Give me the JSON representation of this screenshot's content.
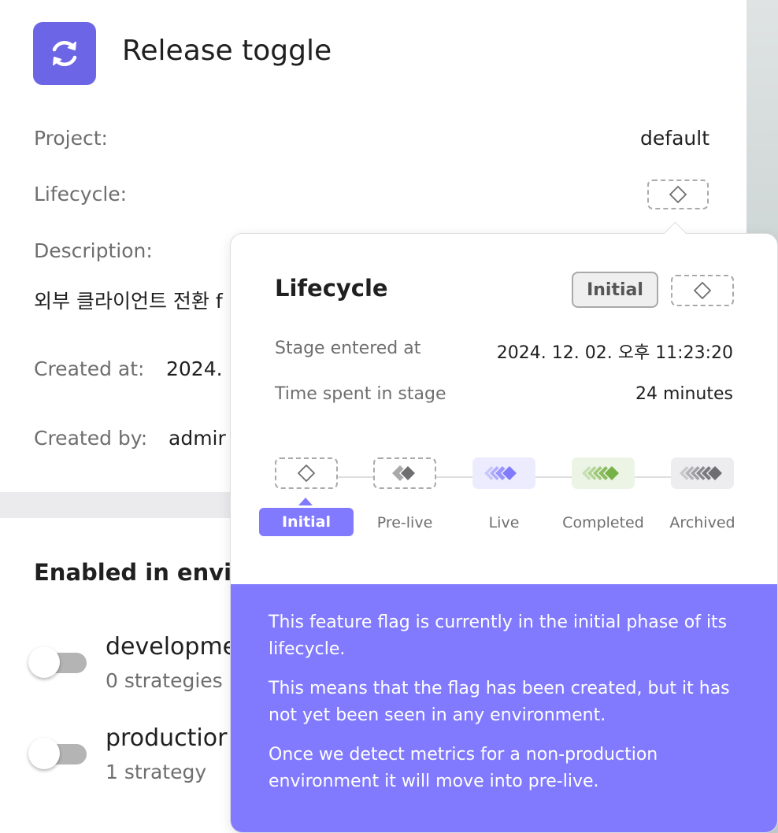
{
  "flag": {
    "title": "Release toggle",
    "project_label": "Project:",
    "project_value": "default",
    "lifecycle_label": "Lifecycle:",
    "description_label": "Description:",
    "description_value": "외부 클라이언트 전환 f",
    "created_at_label": "Created at:",
    "created_at_value": "2024.",
    "created_by_label": "Created by:",
    "created_by_value": "admir"
  },
  "environments": {
    "heading": "Enabled in envir",
    "items": [
      {
        "name": "developme",
        "strategies": "0 strategies"
      },
      {
        "name": "productior",
        "strategies": "1 strategy"
      }
    ]
  },
  "lifecycle_popover": {
    "title": "Lifecycle",
    "current_stage": "Initial",
    "stage_entered_label": "Stage entered at",
    "stage_entered_value": "2024. 12. 02. 오후 11:23:20",
    "time_spent_label": "Time spent in stage",
    "time_spent_value": "24 minutes",
    "stages": [
      "Initial",
      "Pre-live",
      "Live",
      "Completed",
      "Archived"
    ],
    "description": [
      "This feature flag is currently in the initial phase of its lifecycle.",
      "This means that the flag has been created, but it has not yet been seen in any environment.",
      "Once we detect metrics for a non-production environment it will move into pre-live."
    ]
  },
  "colors": {
    "accent": "#817afe",
    "icon_bg": "#6c65e5",
    "completed": "#77b248",
    "archived": "#6e6e70"
  },
  "icons": {
    "app": "refresh-arrows-icon",
    "initial": "diamond-outline-icon"
  }
}
